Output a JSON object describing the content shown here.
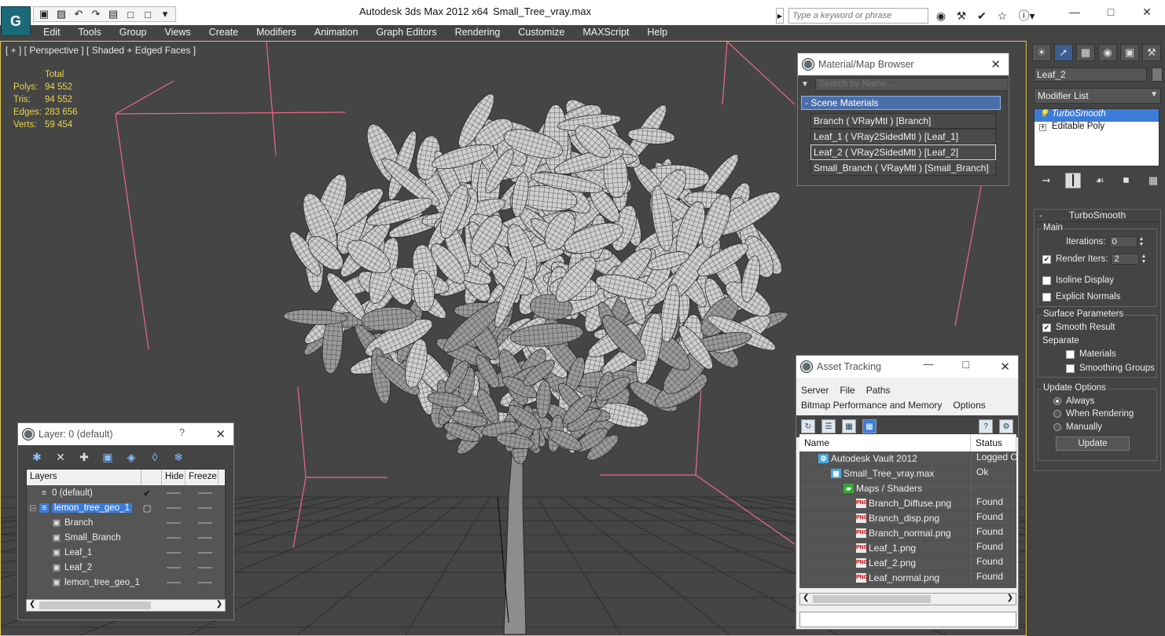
{
  "app": {
    "title": "Autodesk 3ds Max  2012 x64",
    "file": "Small_Tree_vray.max",
    "logo": "3ds-max-logo",
    "search_placeholder": "Type a keyword or phrase"
  },
  "menu": [
    "Edit",
    "Tools",
    "Group",
    "Views",
    "Create",
    "Modifiers",
    "Animation",
    "Graph Editors",
    "Rendering",
    "Customize",
    "MAXScript",
    "Help"
  ],
  "viewport": {
    "label": "[ + ] [ Perspective ] [ Shaded + Edged Faces ]",
    "stats": {
      "header": "Total",
      "rows": [
        {
          "k": "Polys:",
          "v": "94 552"
        },
        {
          "k": "Tris:",
          "v": "94 552"
        },
        {
          "k": "Edges:",
          "v": "283 656"
        },
        {
          "k": "Verts:",
          "v": "59 454"
        }
      ]
    }
  },
  "material_browser": {
    "title": "Material/Map Browser",
    "search_placeholder": "Search by Name ...",
    "section": "- Scene Materials",
    "items": [
      {
        "label": "Branch  ( VRayMtl ) [Branch]",
        "selected": false
      },
      {
        "label": "Leaf_1  ( VRay2SidedMtl ) [Leaf_1]",
        "selected": false
      },
      {
        "label": "Leaf_2  ( VRay2SidedMtl ) [Leaf_2]",
        "selected": true
      },
      {
        "label": "Small_Branch  ( VRayMtl ) [Small_Branch]",
        "selected": false
      }
    ]
  },
  "layer_window": {
    "title": "Layer: 0 (default)",
    "help": "?",
    "columns": {
      "layers": "Layers",
      "hide": "Hide",
      "freeze": "Freeze"
    },
    "rows": [
      {
        "name": "0 (default)",
        "indent": 1,
        "checked": true,
        "selected": false,
        "icon": "layer-icon"
      },
      {
        "name": "lemon_tree_geo_1",
        "indent": 1,
        "checked": false,
        "selected": true,
        "icon": "layer-icon"
      },
      {
        "name": "Branch",
        "indent": 2,
        "checked": false,
        "selected": false,
        "icon": "object-icon"
      },
      {
        "name": "Small_Branch",
        "indent": 2,
        "checked": false,
        "selected": false,
        "icon": "object-icon"
      },
      {
        "name": "Leaf_1",
        "indent": 2,
        "checked": false,
        "selected": false,
        "icon": "object-icon"
      },
      {
        "name": "Leaf_2",
        "indent": 2,
        "checked": false,
        "selected": false,
        "icon": "object-icon"
      },
      {
        "name": "lemon_tree_geo_1",
        "indent": 2,
        "checked": false,
        "selected": false,
        "icon": "object-icon"
      }
    ]
  },
  "asset_tracking": {
    "title": "Asset Tracking",
    "menu1": [
      "Server",
      "File",
      "Paths"
    ],
    "menu2": [
      "Bitmap Performance and Memory",
      "Options"
    ],
    "columns": {
      "name": "Name",
      "status": "Status"
    },
    "rows": [
      {
        "name": "Autodesk Vault 2012",
        "status": "Logged O",
        "indent": 1,
        "icon": "vault"
      },
      {
        "name": "Small_Tree_vray.max",
        "status": "Ok",
        "indent": 2,
        "icon": "max"
      },
      {
        "name": "Maps / Shaders",
        "status": "",
        "indent": 3,
        "icon": "maps"
      },
      {
        "name": "Branch_Diffuse.png",
        "status": "Found",
        "indent": 4,
        "icon": "png"
      },
      {
        "name": "Branch_disp.png",
        "status": "Found",
        "indent": 4,
        "icon": "png"
      },
      {
        "name": "Branch_normal.png",
        "status": "Found",
        "indent": 4,
        "icon": "png"
      },
      {
        "name": "Leaf_1.png",
        "status": "Found",
        "indent": 4,
        "icon": "png"
      },
      {
        "name": "Leaf_2.png",
        "status": "Found",
        "indent": 4,
        "icon": "png"
      },
      {
        "name": "Leaf_normal.png",
        "status": "Found",
        "indent": 4,
        "icon": "png"
      }
    ]
  },
  "command_panel": {
    "object_name": "Leaf_2",
    "modifier_list": "Modifier List",
    "stack": [
      {
        "label": "TurboSmooth",
        "selected": true
      },
      {
        "label": "Editable Poly",
        "selected": false
      }
    ],
    "turbosmooth": {
      "title": "TurboSmooth",
      "main": "Main",
      "iterations_label": "Iterations:",
      "iterations": "0",
      "render_iters_label": "Render Iters:",
      "render_iters": "2",
      "isoline": "Isoline Display",
      "explicit": "Explicit Normals",
      "surface": "Surface Parameters",
      "smooth_result": "Smooth Result",
      "separate": "Separate",
      "materials": "Materials",
      "smoothing_groups": "Smoothing Groups",
      "update_options": "Update Options",
      "always": "Always",
      "when_rendering": "When Rendering",
      "manually": "Manually",
      "update": "Update"
    }
  },
  "colors": {
    "viewport_border": "#e6c84a",
    "stats_text": "#e8d64a",
    "selection": "#3d7bd8",
    "bbox": "#e86a8a"
  }
}
